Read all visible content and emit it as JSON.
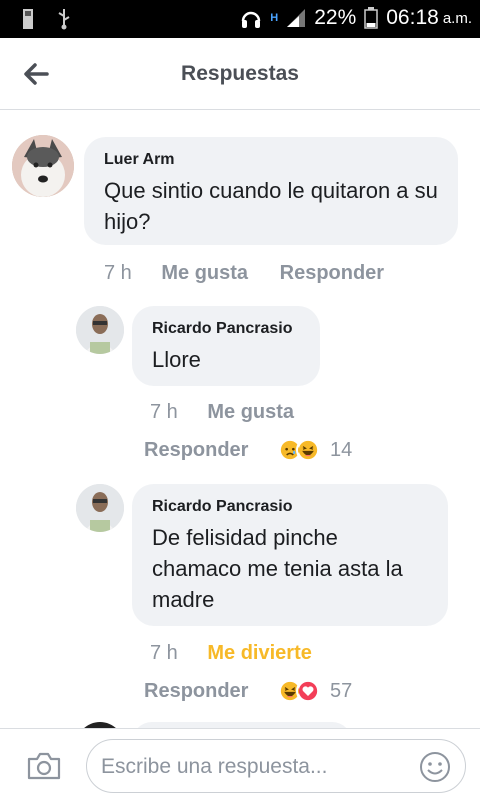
{
  "status_bar": {
    "network": "H",
    "battery": "22%",
    "time": "06:18",
    "ampm": "a.m."
  },
  "header": {
    "title": "Respuestas"
  },
  "comments": [
    {
      "author": "Luer Arm",
      "text": "Que sintio cuando le quitaron a su hijo?",
      "time": "7 h",
      "like": "Me gusta",
      "reply": "Responder"
    },
    {
      "author": "Ricardo Pancrasio",
      "text": "Llore",
      "time": "7 h",
      "like": "Me gusta",
      "reply": "Responder",
      "reaction_count": "14"
    },
    {
      "author": "Ricardo Pancrasio",
      "text": "De felisidad pinche chamaco me tenia asta la madre",
      "time": "7 h",
      "like": "Me divierte",
      "reply": "Responder",
      "reaction_count": "57"
    }
  ],
  "composer": {
    "placeholder": "Escribe una respuesta..."
  },
  "colors": {
    "haha": "#f7b928",
    "meta": "#8d949e",
    "bubble": "#f0f2f5"
  }
}
